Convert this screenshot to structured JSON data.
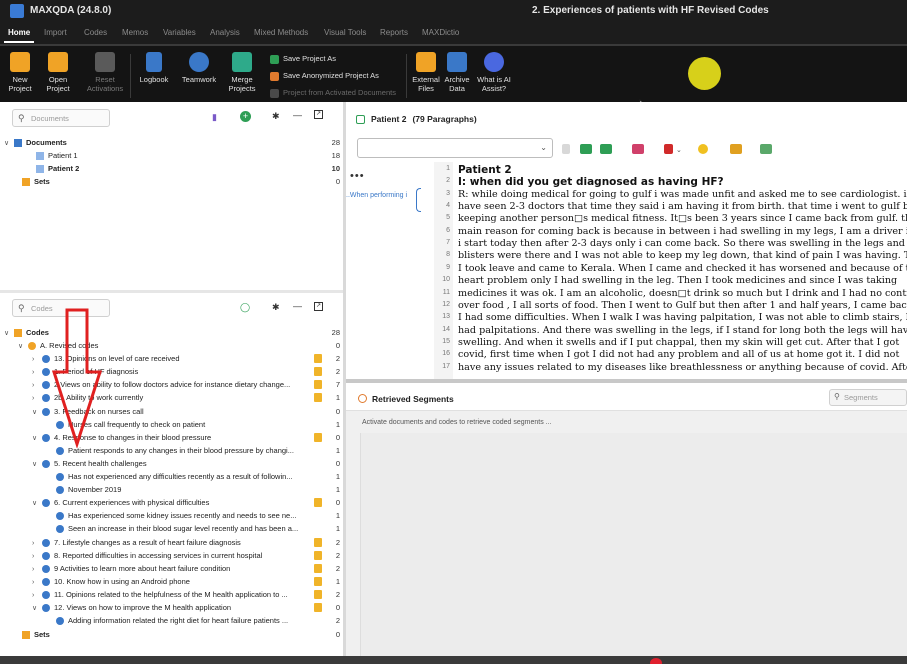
{
  "window": {
    "app_title": "MAXQDA (24.8.0)",
    "document_title": "2. Experiences of patients with HF Revised Codes"
  },
  "menu_tabs": [
    "Home",
    "Import",
    "Codes",
    "Memos",
    "Variables",
    "Analysis",
    "Mixed Methods",
    "Visual Tools",
    "Reports",
    "MAXDictio"
  ],
  "active_tab": "Home",
  "ribbon": {
    "new_project": "New\nProject",
    "open_project": "Open\nProject",
    "reset_activations": "Reset\nActivations",
    "logbook": "Logbook",
    "teamwork": "Teamwork",
    "merge_projects": "Merge\nProjects",
    "save_project_as": "Save Project As",
    "save_anonymized": "Save Anonymized Project As",
    "project_from_activated": "Project from Activated Documents",
    "external_files": "External\nFiles",
    "archive_data": "Archive\nData",
    "ai_assist": "What is AI\nAssist?"
  },
  "documents_pane": {
    "search_placeholder": "Documents",
    "root_label": "Documents",
    "root_count": "28",
    "items": [
      {
        "label": "Patient 1",
        "count": "18"
      },
      {
        "label": "Patient 2",
        "count": "10"
      }
    ],
    "sets_label": "Sets",
    "sets_count": "0"
  },
  "codes_pane": {
    "search_placeholder": "Codes",
    "root_label": "Codes",
    "root_count": "28",
    "items": [
      {
        "label": "A. Revised codes",
        "count": "0",
        "level": 1,
        "chev": "v",
        "memo": false
      },
      {
        "label": "13. Opinions on level of care received",
        "count": "2",
        "level": 2,
        "chev": ">",
        "memo": true
      },
      {
        "label": "1. Period of HF diagnosis",
        "count": "2",
        "level": 2,
        "chev": ">",
        "memo": true
      },
      {
        "label": "2.Views on ability to follow doctors advice for instance dietary change...",
        "count": "7",
        "level": 2,
        "chev": ">",
        "memo": true
      },
      {
        "label": "2b. Ability to work currently",
        "count": "1",
        "level": 2,
        "chev": ">",
        "memo": true
      },
      {
        "label": "3. Feedback on nurses call",
        "count": "0",
        "level": 2,
        "chev": "v",
        "memo": false
      },
      {
        "label": "Nurses call frequently to check on patient",
        "count": "1",
        "level": 3,
        "chev": "",
        "memo": false
      },
      {
        "label": "4. Response to changes in their blood pressure",
        "count": "0",
        "level": 2,
        "chev": "v",
        "memo": true
      },
      {
        "label": "Patient responds to any changes in their blood pressure by changi...",
        "count": "1",
        "level": 3,
        "chev": "",
        "memo": false
      },
      {
        "label": "5.  Recent health challenges",
        "count": "0",
        "level": 2,
        "chev": "v",
        "memo": false
      },
      {
        "label": "Has not experienced any difficulties recently as a result of followin...",
        "count": "1",
        "level": 3,
        "chev": "",
        "memo": false
      },
      {
        "label": "November 2019",
        "count": "1",
        "level": 3,
        "chev": "",
        "memo": false
      },
      {
        "label": "6. Current experiences with physical difficulties",
        "count": "0",
        "level": 2,
        "chev": "v",
        "memo": true
      },
      {
        "label": "Has experienced some kidney issues recently and needs to see ne...",
        "count": "1",
        "level": 3,
        "chev": "",
        "memo": false
      },
      {
        "label": "Seen an increase in their blood sugar level recently and has been a...",
        "count": "1",
        "level": 3,
        "chev": "",
        "memo": false
      },
      {
        "label": "7. Lifestyle changes as a result of heart failure diagnosis",
        "count": "2",
        "level": 2,
        "chev": ">",
        "memo": true
      },
      {
        "label": "8. Reported difficulties in accessing services in current hospital",
        "count": "2",
        "level": 2,
        "chev": ">",
        "memo": true
      },
      {
        "label": "9 Activities to learn more about heart failure condition",
        "count": "2",
        "level": 2,
        "chev": ">",
        "memo": true
      },
      {
        "label": "10. Know how in using an Android phone",
        "count": "1",
        "level": 2,
        "chev": ">",
        "memo": true
      },
      {
        "label": "11. Opinions related to the helpfulness of the M health application to ...",
        "count": "2",
        "level": 2,
        "chev": ">",
        "memo": true
      },
      {
        "label": "12. Views on how to improve the M health application",
        "count": "0",
        "level": 2,
        "chev": "v",
        "memo": true
      },
      {
        "label": "Adding information related the right diet for heart failure patients ...",
        "count": "2",
        "level": 3,
        "chev": "",
        "memo": false
      }
    ],
    "sets_label": "Sets",
    "sets_count": "0"
  },
  "document_browser": {
    "doc_name": "Patient 2",
    "paragraphs": "(79 Paragraphs)",
    "code_stripe_label": "..When performing i",
    "lines": [
      {
        "n": "1",
        "t": "Patient 2",
        "bold": true
      },
      {
        "n": "2",
        "t": "I: when did you get diagnosed as having HF?",
        "bold": true
      },
      {
        "n": "3",
        "t": "R: while doing medical for going to gulf i was made unfit and asked me to see cardiologist. i",
        "bold": false
      },
      {
        "n": "4",
        "t": "have seen 2-3 doctors that time they said i am having it from birth. that time i went to gulf by",
        "bold": false
      },
      {
        "n": "5",
        "t": "keeping another person□s medical fitness. It□s been 3 years since I came back from gulf. the",
        "bold": false
      },
      {
        "n": "6",
        "t": "main reason for coming back is because in between i had swelling in my legs, I am a driver if",
        "bold": false
      },
      {
        "n": "7",
        "t": "i start today then after 2-3 days only i can come back. So there was swelling in the legs and",
        "bold": false
      },
      {
        "n": "8",
        "t": "blisters were there and I was not able to keep my leg down, that kind of pain I was having. Then",
        "bold": false
      },
      {
        "n": "9",
        "t": "I took leave and came to Kerala. When I came and checked it has worsened and because of the",
        "bold": false
      },
      {
        "n": "10",
        "t": "heart problem only I had swelling in the leg. Then I took medicines and since I was taking",
        "bold": false
      },
      {
        "n": "11",
        "t": "medicines it was ok. I am an alcoholic, doesn□t drink so much but I drink and I had no control",
        "bold": false
      },
      {
        "n": "12",
        "t": "over food , I all sorts of food. Then I went to Gulf but then after 1 and half years, I came back",
        "bold": false
      },
      {
        "n": "13",
        "t": "I had some difficulties. When I walk I was having palpitation, I was not able to climb stairs, I",
        "bold": false
      },
      {
        "n": "14",
        "t": "had palpitations. And there was swelling in the legs, if I stand for long both the legs will have",
        "bold": false
      },
      {
        "n": "15",
        "t": "swelling. And when it swells and if I put chappal, then my skin will get cut. After that I got",
        "bold": false
      },
      {
        "n": "16",
        "t": "covid, first time when I got I did not had any problem and all of us at home got it. I did not",
        "bold": false
      },
      {
        "n": "17",
        "t": "have any issues related to my diseases like breathlessness or anything because of covid. After",
        "bold": false
      }
    ]
  },
  "retrieved_segments": {
    "title": "Retrieved Segments",
    "search_placeholder": "Segments",
    "message": "Activate documents and codes to retrieve coded segments ..."
  },
  "colors": {
    "accent_blue": "#3a78c8",
    "memo_yellow": "#f0b429",
    "annotation_red": "#e02020",
    "cursor_yellow": "#d7d01a"
  }
}
